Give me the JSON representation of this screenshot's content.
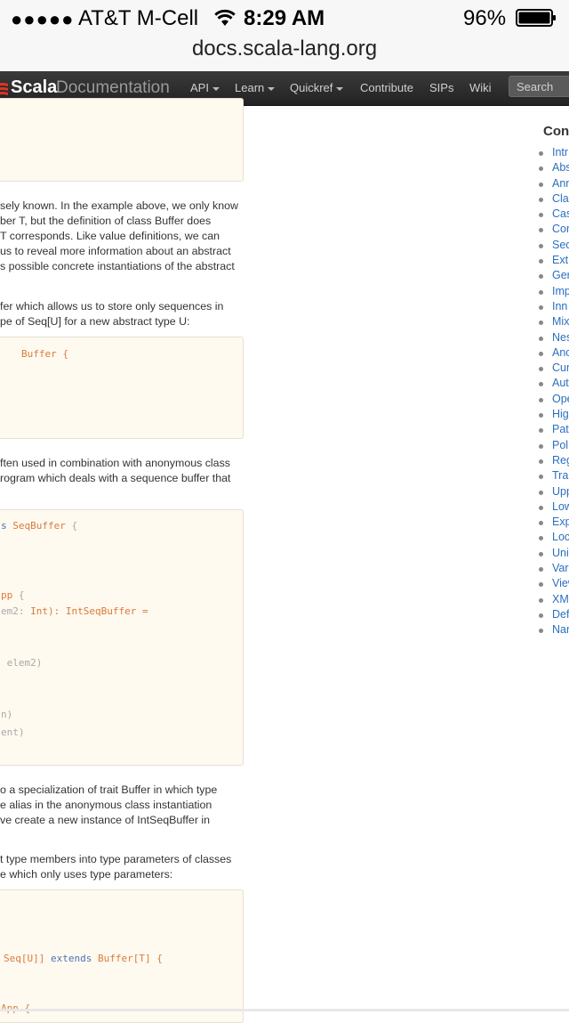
{
  "status_bar": {
    "signal": "●●●●●",
    "carrier": "AT&T M-Cell",
    "time": "8:29 AM",
    "battery": "96%",
    "url": "docs.scala-lang.org"
  },
  "navbar": {
    "logo_scala": "Scala",
    "logo_documentation": "Documentation",
    "items": [
      {
        "label": "API"
      },
      {
        "label": "Learn"
      },
      {
        "label": "Quickref"
      },
      {
        "label": "Contribute"
      },
      {
        "label": "SIPs"
      },
      {
        "label": "Wiki"
      }
    ],
    "search_placeholder": "Search"
  },
  "content": {
    "para1": [
      "sely known. In the example above, we only know",
      "ber T, but the definition of class Buffer does",
      "T corresponds. Like value definitions, we can",
      "us to reveal more information about an abstract",
      "s possible concrete instantiations of the abstract"
    ],
    "para2": [
      "fer which allows us to store only sequences in",
      "pe of Seq[U] for a new abstract type U:"
    ],
    "code2": "Buffer {",
    "para3": [
      "ften used in combination with anonymous class",
      "rogram which deals with a sequence buffer that"
    ],
    "code3": [
      {
        "a": "s ",
        "b": "SeqBuffer",
        "c": " {"
      },
      {
        "a": "pp",
        "b": " {",
        "c": ""
      },
      {
        "a": "em2: ",
        "b": "Int): IntSeqBuffer =",
        "c": ""
      },
      {
        "a": " elem2)",
        "b": "",
        "c": ""
      },
      {
        "a": "n)",
        "b": "",
        "c": ""
      },
      {
        "a": "ent)",
        "b": "",
        "c": ""
      }
    ],
    "para4": [
      "o a specialization of trait Buffer in which type",
      "e alias in the anonymous class instantiation",
      "ve create a new instance of IntSeqBuffer in"
    ],
    "para5": [
      "t type members into type parameters of classes",
      "e which only uses type parameters:"
    ],
    "code5": [
      {
        "a": "Seq[U]] ",
        "b": "extends",
        "c": " Buffer[T] {"
      },
      {
        "a": "App {",
        "b": "",
        "c": ""
      }
    ]
  },
  "toc": {
    "title": "Con",
    "items": [
      "Intr",
      "Abs",
      "Ann",
      "Cla",
      "Cas",
      "Cor",
      "Sec",
      "Ext",
      "Ger",
      "Imp",
      "Inn",
      "Mix",
      "Nes",
      "Anc",
      "Cur",
      "Aut",
      "Ope",
      "Hig",
      "Pat",
      "Pol",
      "Reg",
      "Trai",
      "Upp",
      "Low",
      "Exp",
      "Loc",
      "Uni",
      "Vari",
      "View",
      "XM",
      "Def",
      "Nar"
    ]
  }
}
